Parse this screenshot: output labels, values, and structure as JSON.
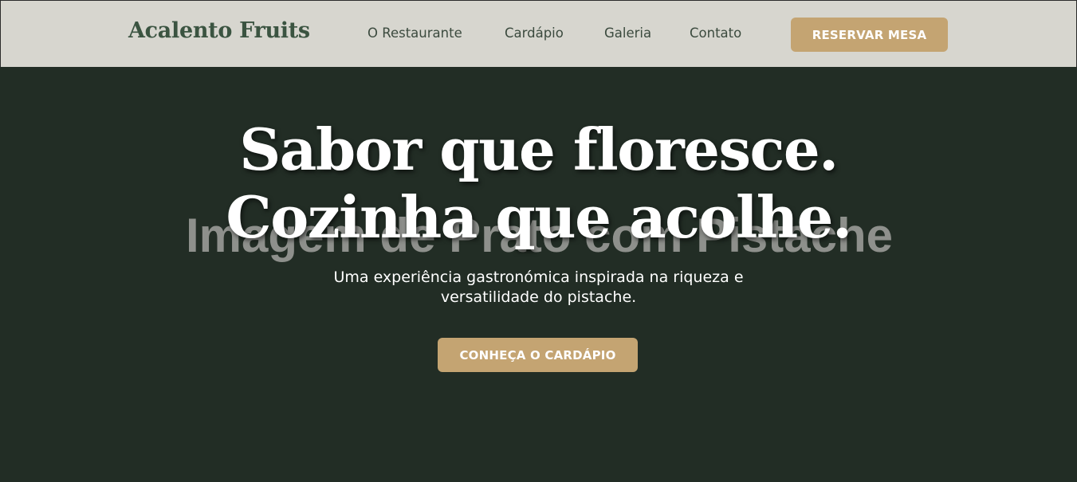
{
  "header": {
    "logo": "Acalento Fruits",
    "nav": [
      {
        "label": "O Restaurante"
      },
      {
        "label": "Cardápio"
      },
      {
        "label": "Galeria"
      },
      {
        "label": "Contato"
      }
    ],
    "cta_label": "RESERVAR MESA"
  },
  "hero": {
    "image_placeholder": "Imagem de Prato com Pistache",
    "headline_line1": "Sabor que floresce.",
    "headline_line2": "Cozinha que acolhe.",
    "subtitle_line1": "Uma experiência gastronómica inspirada na riqueza e",
    "subtitle_line2": "versatilidade do pistache.",
    "cta_label": "CONHEÇA O CARDÁPIO"
  },
  "colors": {
    "header_bg": "#d7d6cf",
    "hero_bg": "#222d25",
    "accent": "#c4a472",
    "logo": "#3b5441"
  }
}
